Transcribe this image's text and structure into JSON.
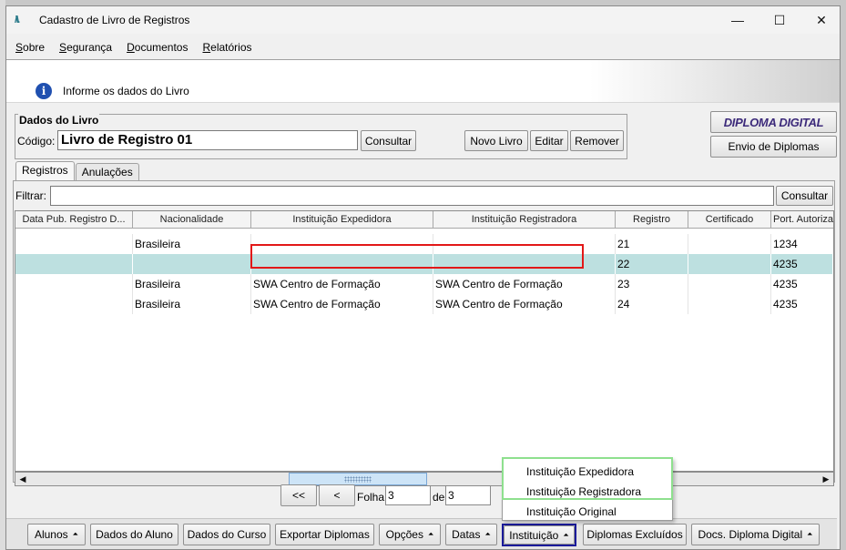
{
  "window": {
    "title": "Cadastro de Livro de Registros",
    "minimize": "—",
    "maximize": "☐",
    "close": "✕"
  },
  "menu": [
    {
      "label": "Sobre"
    },
    {
      "label": "Segurança"
    },
    {
      "label": "Documentos"
    },
    {
      "label": "Relatórios"
    }
  ],
  "info": {
    "icon": "info-icon",
    "icon_glyph": "i",
    "text": "Informe os dados do Livro"
  },
  "dados_livro": {
    "legend": "Dados do Livro",
    "codigo_label": "Código:",
    "codigo_value": "Livro de Registro 01",
    "consultar_label": "Consultar",
    "novo_livro_label": "Novo Livro",
    "editar_label": "Editar",
    "remover_label": "Remover"
  },
  "right_buttons": {
    "diploma_logo": "DIPLOMA DIGITAL",
    "envio_label": "Envio de Diplomas"
  },
  "tabs": [
    {
      "label": "Registros",
      "active": true
    },
    {
      "label": "Anulações",
      "active": false
    }
  ],
  "filter": {
    "label": "Filtrar:",
    "value": "",
    "consultar_label": "Consultar"
  },
  "grid": {
    "columns": [
      "Data Pub. Registro D...",
      "Nacionalidade",
      "Instituição Expedidora",
      "Instituição Registradora",
      "Registro",
      "Certificado",
      "Port. Autorizaç"
    ],
    "rows": [
      [
        "",
        "Brasileira",
        "",
        "",
        "21",
        "",
        "1234"
      ],
      [
        "",
        "",
        "",
        "",
        "22",
        "",
        "4235"
      ],
      [
        "",
        "Brasileira",
        "SWA Centro de Formação",
        "SWA Centro de Formação",
        "23",
        "",
        "4235"
      ],
      [
        "",
        "Brasileira",
        "SWA Centro de Formação",
        "SWA Centro de Formação",
        "24",
        "",
        "4235"
      ]
    ],
    "selected_row": 1
  },
  "pager": {
    "first_label": "<<",
    "prev_label": "<",
    "folha_label": "Folha",
    "folha_value": "3",
    "de_label": "de",
    "total_value": "3"
  },
  "bottom_buttons": [
    {
      "label": "Alunos",
      "arrow": "⏶"
    },
    {
      "label": "Dados do Aluno"
    },
    {
      "label": "Dados do Curso"
    },
    {
      "label": "Exportar Diplomas"
    },
    {
      "label": "Opções",
      "arrow": "⏶"
    },
    {
      "label": "Datas",
      "arrow": "⏶"
    },
    {
      "label": "Instituição",
      "arrow": "⏶"
    },
    {
      "label": "Diplomas Excluídos"
    },
    {
      "label": "Docs. Diploma Digital",
      "arrow": "⏶"
    }
  ],
  "instituicao_menu": {
    "items": [
      "Instituição Expedidora",
      "Instituição Registradora",
      "Instituição Original"
    ]
  },
  "colors": {
    "selected_row": "#bde0e0",
    "highlight_red": "#e21818",
    "highlight_green": "#8ee08e",
    "highlight_blue": "#1a1a9a"
  }
}
